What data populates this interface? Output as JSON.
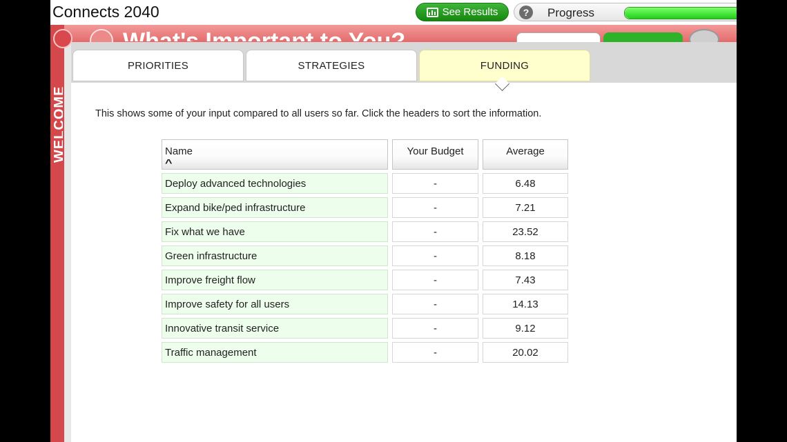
{
  "app": {
    "title": "Connects 2040"
  },
  "header": {
    "see_results_label": "See Results",
    "help_glyph": "?",
    "progress_label": "Progress",
    "progress_fraction": 0.95
  },
  "background": {
    "title": "What's Important to You?",
    "sidebar_label": "WELCOME"
  },
  "tabs": [
    {
      "label": "PRIORITIES",
      "active": false
    },
    {
      "label": "STRATEGIES",
      "active": false
    },
    {
      "label": "FUNDING",
      "active": true
    }
  ],
  "intro": "This shows some of your input compared to all users so far. Click the headers to sort the information.",
  "table": {
    "columns": [
      "Name",
      "Your Budget",
      "Average"
    ],
    "sorted_column": "Name",
    "sort_direction": "ascending",
    "rows": [
      {
        "name": "Deploy advanced technologies",
        "budget": "-",
        "average": "6.48"
      },
      {
        "name": "Expand bike/ped infrastructure",
        "budget": "-",
        "average": "7.21"
      },
      {
        "name": "Fix what we have",
        "budget": "-",
        "average": "23.52"
      },
      {
        "name": "Green infrastructure",
        "budget": "-",
        "average": "8.18"
      },
      {
        "name": "Improve freight flow",
        "budget": "-",
        "average": "7.43"
      },
      {
        "name": "Improve safety for all users",
        "budget": "-",
        "average": "14.13"
      },
      {
        "name": "Innovative transit service",
        "budget": "-",
        "average": "9.12"
      },
      {
        "name": "Traffic management",
        "budget": "-",
        "average": "20.02"
      }
    ]
  },
  "colors": {
    "accent_red": "#d4474b",
    "success_green": "#1f9a16",
    "active_tab": "#ffffce",
    "name_cell": "#eefeec"
  },
  "icons": {
    "see_results": "bar-chart-icon",
    "help": "help-icon",
    "sort": "chevron-up-icon"
  }
}
